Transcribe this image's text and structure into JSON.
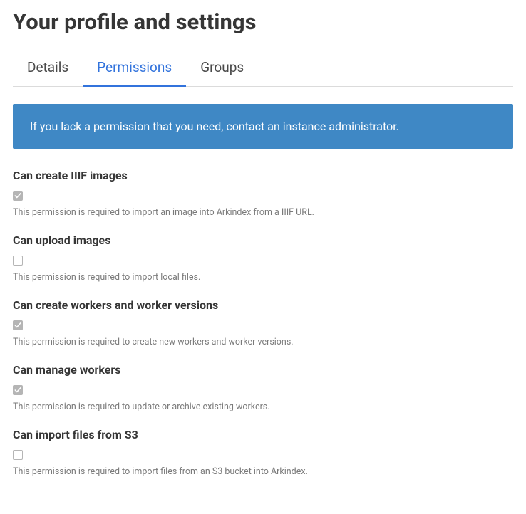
{
  "page_title": "Your profile and settings",
  "tabs": [
    {
      "label": "Details",
      "active": false
    },
    {
      "label": "Permissions",
      "active": true
    },
    {
      "label": "Groups",
      "active": false
    }
  ],
  "banner": "If you lack a permission that you need, contact an instance administrator.",
  "permissions": [
    {
      "title": "Can create IIIF images",
      "checked": true,
      "desc": "This permission is required to import an image into Arkindex from a IIIF URL."
    },
    {
      "title": "Can upload images",
      "checked": false,
      "desc": "This permission is required to import local files."
    },
    {
      "title": "Can create workers and worker versions",
      "checked": true,
      "desc": "This permission is required to create new workers and worker versions."
    },
    {
      "title": "Can manage workers",
      "checked": true,
      "desc": "This permission is required to update or archive existing workers."
    },
    {
      "title": "Can import files from S3",
      "checked": false,
      "desc": "This permission is required to import files from an S3 bucket into Arkindex."
    }
  ]
}
